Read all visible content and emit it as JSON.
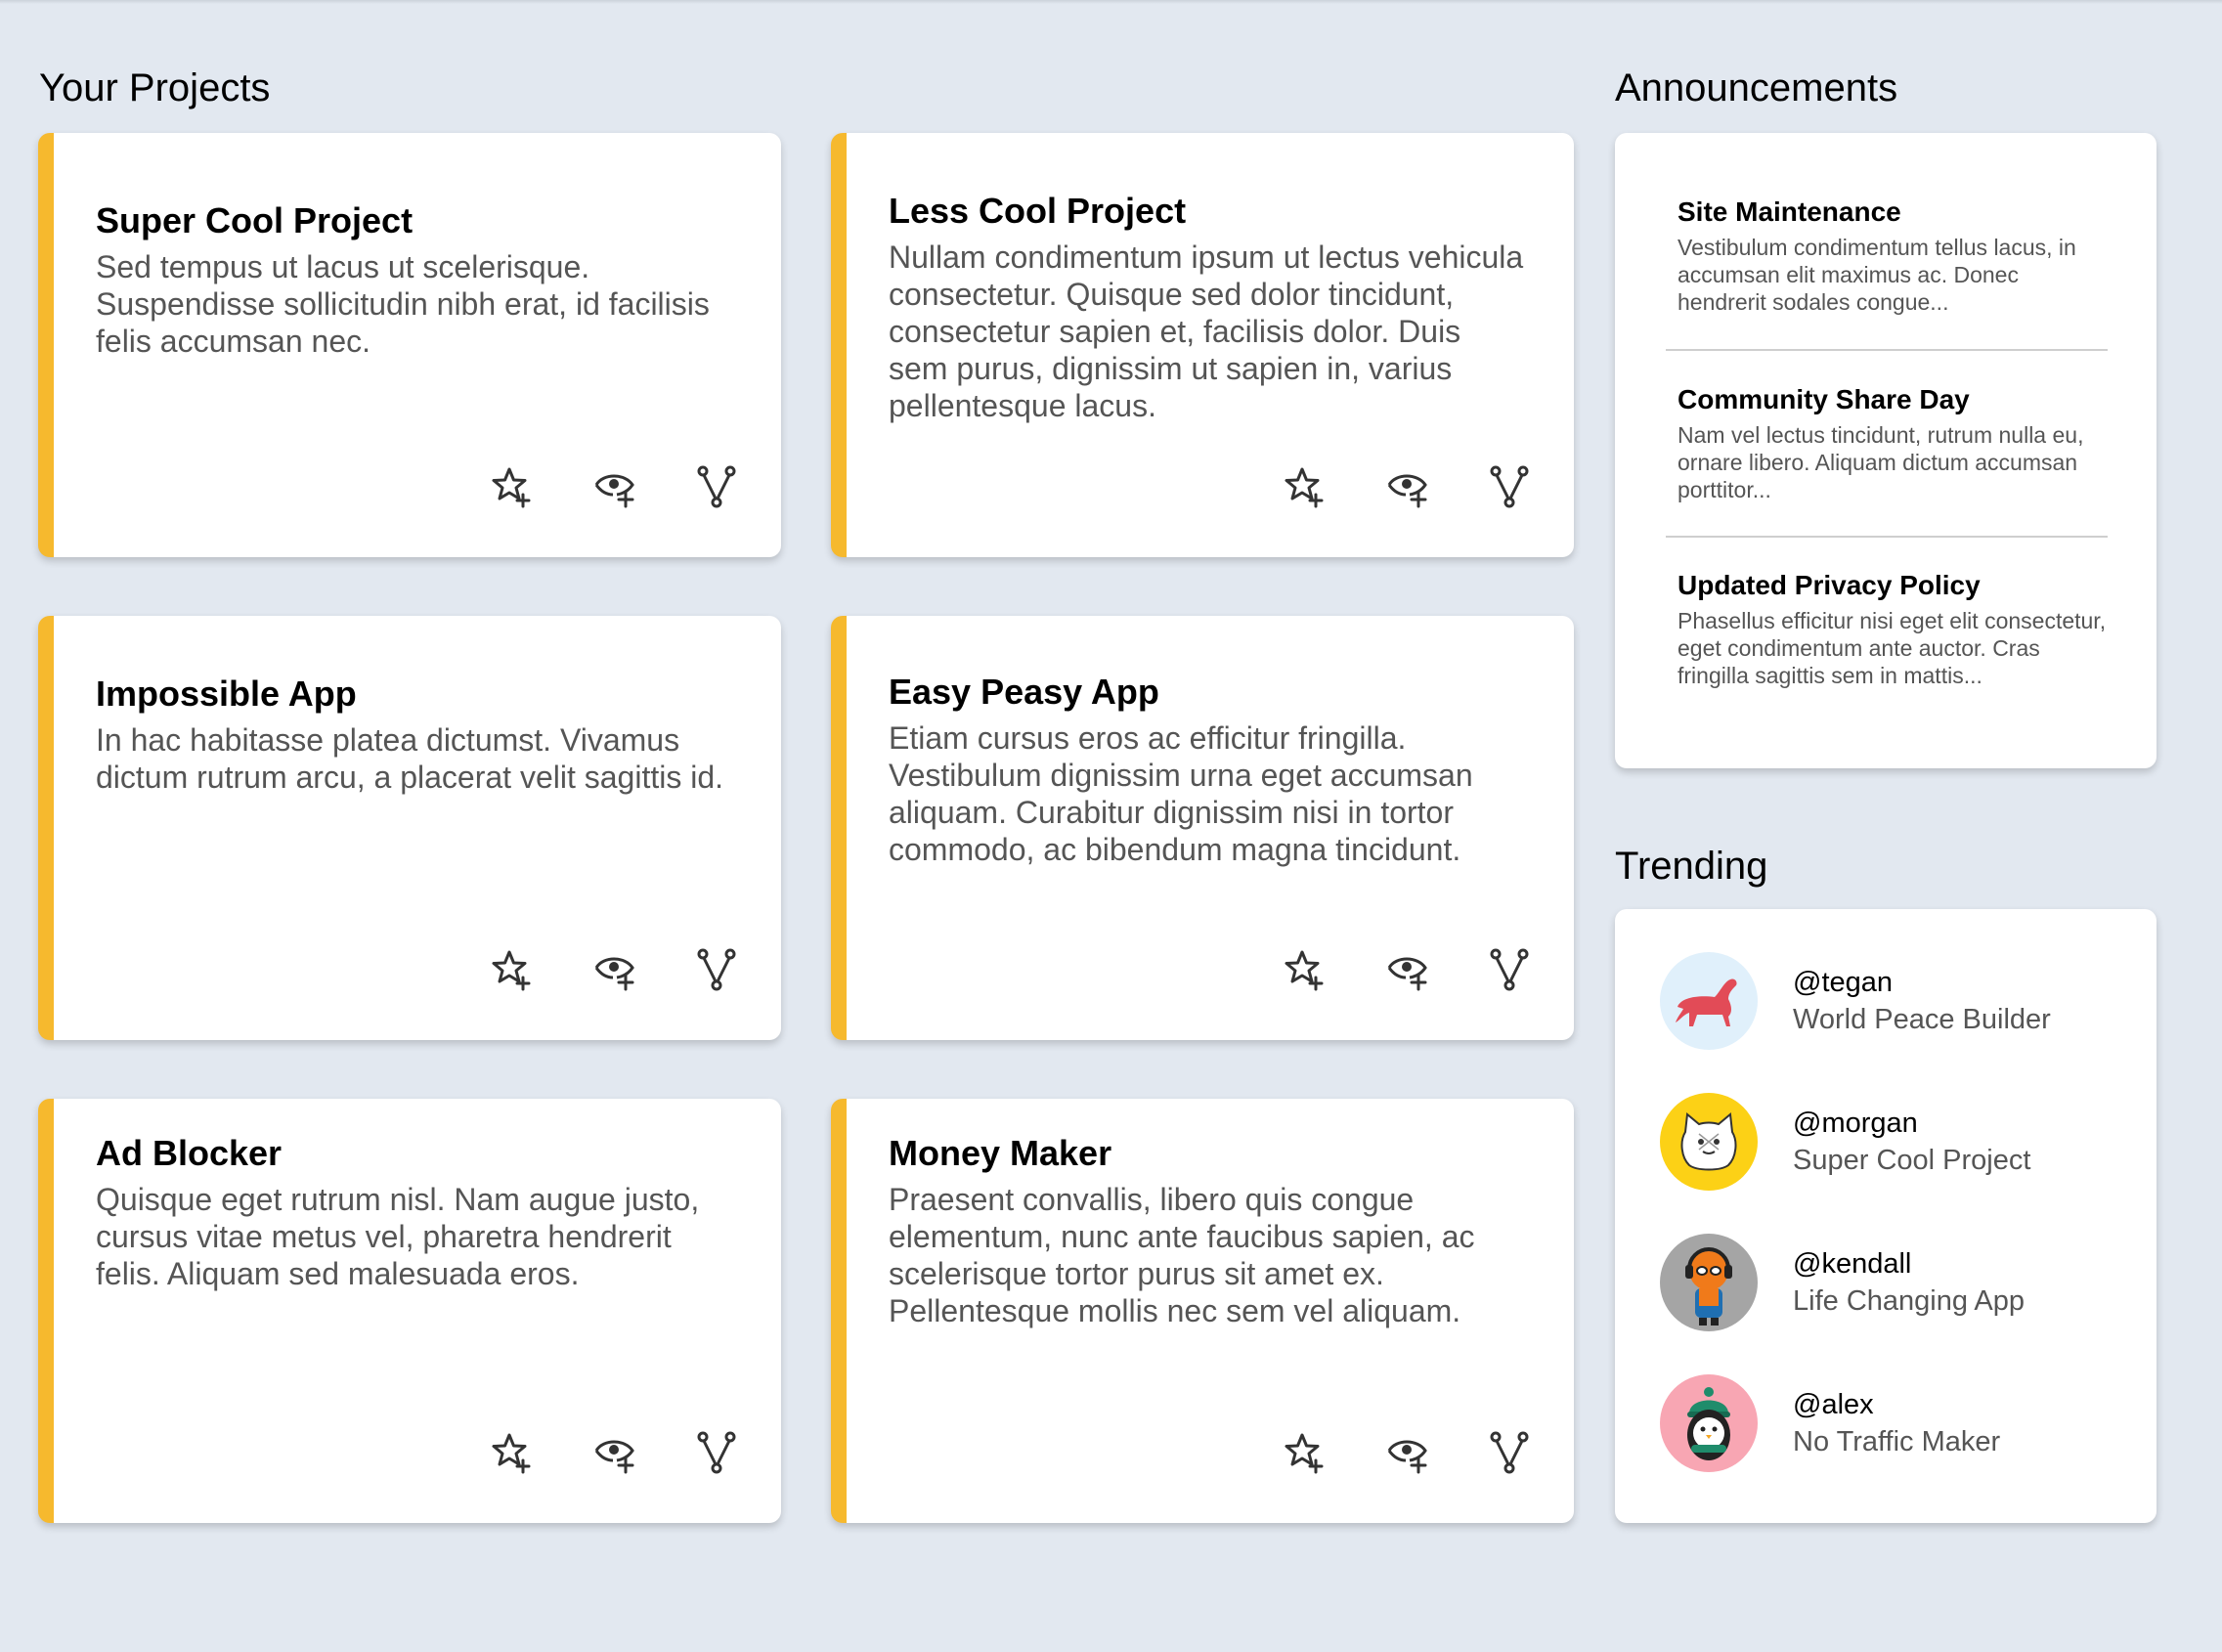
{
  "sections": {
    "projects_title": "Your Projects",
    "announcements_title": "Announcements",
    "trending_title": "Trending"
  },
  "projects": [
    {
      "title": "Super Cool Project",
      "description": "Sed tempus ut lacus ut scelerisque. Suspendisse sollicitudin nibh erat, id facilisis felis accumsan nec."
    },
    {
      "title": "Less Cool Project",
      "description": "Nullam condimentum ipsum ut lectus vehicula consectetur. Quisque sed dolor tincidunt, consectetur sapien et, facilisis dolor. Duis sem purus, dignissim ut sapien in, varius pellentesque lacus."
    },
    {
      "title": "Impossible App",
      "description": "In hac habitasse platea dictumst. Vivamus dictum rutrum arcu, a placerat velit sagittis id."
    },
    {
      "title": "Easy Peasy App",
      "description": "Etiam cursus eros ac efficitur fringilla. Vestibulum dignissim urna eget accumsan aliquam. Curabitur dignissim nisi in tortor commodo, ac bibendum magna tincidunt."
    },
    {
      "title": "Ad Blocker",
      "description": "Quisque eget rutrum nisl. Nam augue justo, cursus vitae metus vel, pharetra hendrerit felis. Aliquam sed malesuada eros."
    },
    {
      "title": "Money Maker",
      "description": "Praesent convallis, libero quis congue elementum, nunc ante faucibus sapien, ac scelerisque tortor purus sit amet ex. Pellentesque mollis nec sem vel aliquam."
    }
  ],
  "project_actions": [
    "star-plus-icon",
    "eye-plus-icon",
    "fork-icon"
  ],
  "announcements": [
    {
      "title": "Site Maintenance",
      "body": "Vestibulum condimentum tellus lacus, in accumsan elit maximus ac. Donec hendrerit sodales congue..."
    },
    {
      "title": "Community Share Day",
      "body": "Nam vel lectus tincidunt, rutrum nulla eu, ornare libero. Aliquam dictum accumsan porttitor..."
    },
    {
      "title": "Updated Privacy Policy",
      "body": "Phasellus efficitur nisi eget elit consectetur, eget condimentum ante auctor. Cras fringilla sagittis sem in mattis..."
    }
  ],
  "trending": [
    {
      "user": "@tegan",
      "project": "World Peace Builder",
      "avatar": "dog-avatar",
      "avatar_bg": "#e0f0fb"
    },
    {
      "user": "@morgan",
      "project": "Super Cool Project",
      "avatar": "cat-avatar",
      "avatar_bg": "#fcd116"
    },
    {
      "user": "@kendall",
      "project": "Life Changing App",
      "avatar": "hero-avatar",
      "avatar_bg": "#a5a5a5"
    },
    {
      "user": "@alex",
      "project": "No Traffic Maker",
      "avatar": "penguin-avatar",
      "avatar_bg": "#f8a6b3"
    }
  ],
  "colors": {
    "background": "#e2e8f0",
    "accent": "#f6b92e",
    "card": "#ffffff",
    "muted_text": "#555555"
  }
}
